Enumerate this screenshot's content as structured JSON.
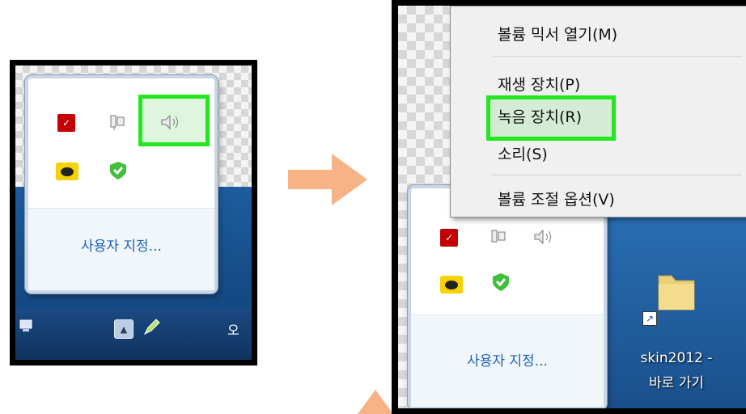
{
  "left_panel": {
    "tray_icons": [
      "pdf-icon",
      "network-icon",
      "speaker-icon",
      "chat-icon",
      "shield-icon"
    ],
    "customize_label": "사용자 지정...",
    "taskbar_text": "오",
    "highlight_color": "#22e61e"
  },
  "arrows": {
    "color": "#f7b386"
  },
  "right_panel": {
    "context_menu": {
      "items": [
        {
          "label": "볼륨 믹서 열기(M)"
        },
        {
          "label": "재생 장치(P)"
        },
        {
          "label": "녹음 장치(R)",
          "highlighted": true
        },
        {
          "label": "소리(S)"
        },
        {
          "label": "볼륨 조절 옵션(V)"
        }
      ]
    },
    "tray_icons": [
      "pdf-icon",
      "network-icon",
      "speaker-icon",
      "chat-icon",
      "shield-icon"
    ],
    "customize_label": "사용자 지정...",
    "desktop_shortcut": {
      "line1": "skin2012 -",
      "line2": "바로 가기"
    }
  }
}
